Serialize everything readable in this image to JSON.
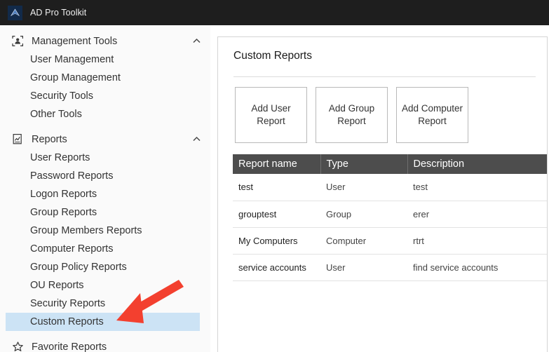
{
  "window": {
    "title": "AD Pro Toolkit",
    "logo_icon": "app-chevron-logo-icon"
  },
  "sidebar": {
    "groups": [
      {
        "label": "Management Tools",
        "icon": "user-frame-icon",
        "chevron": "chevron-up-icon",
        "items": [
          {
            "label": "User Management",
            "selected": false
          },
          {
            "label": "Group Management",
            "selected": false
          },
          {
            "label": "Security Tools",
            "selected": false
          },
          {
            "label": "Other Tools",
            "selected": false
          }
        ]
      },
      {
        "label": "Reports",
        "icon": "report-chart-icon",
        "chevron": "chevron-up-icon",
        "items": [
          {
            "label": "User Reports",
            "selected": false
          },
          {
            "label": "Password Reports",
            "selected": false
          },
          {
            "label": "Logon Reports",
            "selected": false
          },
          {
            "label": "Group Reports",
            "selected": false
          },
          {
            "label": "Group Members Reports",
            "selected": false
          },
          {
            "label": "Computer Reports",
            "selected": false
          },
          {
            "label": "Group Policy Reports",
            "selected": false
          },
          {
            "label": "OU Reports",
            "selected": false
          },
          {
            "label": "Security Reports",
            "selected": false
          },
          {
            "label": "Custom Reports",
            "selected": true
          }
        ]
      },
      {
        "label": "Favorite Reports",
        "icon": "star-icon",
        "chevron": "",
        "items": []
      }
    ]
  },
  "main": {
    "title": "Custom Reports",
    "buttons": [
      {
        "label": "Add User Report"
      },
      {
        "label": "Add Group Report"
      },
      {
        "label": "Add Computer Report"
      }
    ],
    "table": {
      "columns": [
        "Report name",
        "Type",
        "Description"
      ],
      "rows": [
        [
          "test",
          "User",
          "test"
        ],
        [
          "grouptest",
          "Group",
          "erer"
        ],
        [
          "My Computers",
          "Computer",
          "rtrt"
        ],
        [
          "service accounts",
          "User",
          "find service accounts"
        ]
      ]
    }
  },
  "annotation": {
    "arrow_color": "#f3402f",
    "points_to": "Custom Reports"
  },
  "colors": {
    "titlebar_bg": "#1e1e1e",
    "sidebar_bg": "#fafafa",
    "selection_bg": "#cce3f5",
    "table_header_bg": "#4d4d4d",
    "accent_red": "#f3402f"
  }
}
